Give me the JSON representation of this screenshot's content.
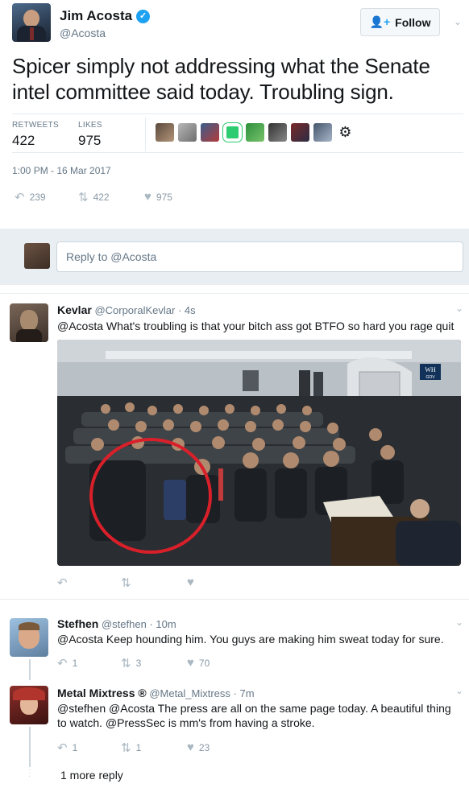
{
  "main_tweet": {
    "name": "Jim Acosta",
    "handle": "@Acosta",
    "follow_label": "Follow",
    "text": "Spicer simply not addressing what the Senate intel committee said today. Troubling sign.",
    "retweets_label": "RETWEETS",
    "retweets": "422",
    "likes_label": "LIKES",
    "likes": "975",
    "timestamp": "1:00 PM - 16 Mar 2017",
    "actions": {
      "reply": "239",
      "retweet": "422",
      "like": "975"
    }
  },
  "reply_box": {
    "placeholder": "Reply to @Acosta"
  },
  "replies": [
    {
      "name": "Kevlar",
      "handle": "@CorporalKevlar",
      "time": "· 4s",
      "text": "@Acosta What's troubling is that your bitch ass got BTFO so hard you rage quit",
      "media_badge_1": "WH",
      "media_badge_2": "GOV"
    },
    {
      "name": "Stefhen",
      "handle": "@stefhen",
      "time": "· 10m",
      "text": "@Acosta Keep hounding him. You guys are making him sweat today for sure.",
      "actions": {
        "reply": "1",
        "retweet": "3",
        "like": "70"
      }
    },
    {
      "name": "Metal Mixtress ®",
      "handle": "@Metal_Mixtress",
      "time": "· 7m",
      "text_line1": "@stefhen @Acosta The press are all on the same page today.  A beautiful thing",
      "text_line2": "to watch.  @PressSec is mm's from having a stroke.",
      "actions": {
        "reply": "1",
        "retweet": "1",
        "like": "23"
      }
    }
  ],
  "more_replies": "1 more reply",
  "colors": {
    "accent": "#1da1f2",
    "muted": "#657786",
    "band": "#e8eef2",
    "circle": "#d9202a"
  },
  "icons": [
    "verified-icon",
    "follow-person-icon",
    "chevron-down-icon",
    "reply-icon",
    "retweet-icon",
    "heart-icon"
  ]
}
